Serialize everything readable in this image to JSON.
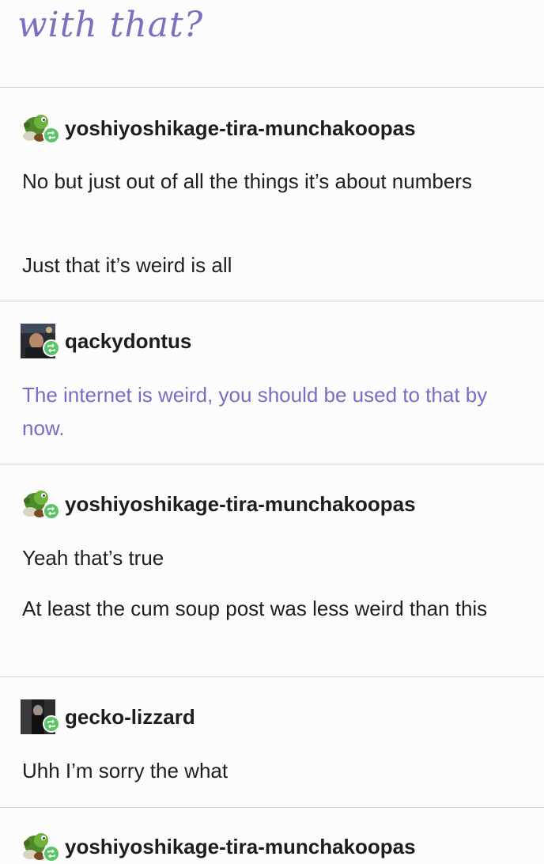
{
  "heading": "with that?",
  "posts": [
    {
      "username": "yoshiyoshikage-tira-munchakoopas",
      "avatar": "yoshi-avatar",
      "paragraphs": [
        "No but just out of all the things it’s about numbers",
        "Just that it’s weird is all"
      ]
    },
    {
      "username": "qackydontus",
      "avatar": "photo-avatar",
      "paragraphs": [
        "The internet is weird, you should be used to that by now."
      ]
    },
    {
      "username": "yoshiyoshikage-tira-munchakoopas",
      "avatar": "yoshi-avatar",
      "paragraphs": [
        "Yeah that’s true",
        "At least the cum soup post was less weird than this"
      ]
    },
    {
      "username": "gecko-lizzard",
      "avatar": "dark-photo-avatar",
      "paragraphs": [
        "Uhh I’m sorry the what"
      ]
    },
    {
      "username": "yoshiyoshikage-tira-munchakoopas",
      "avatar": "yoshi-avatar",
      "paragraphs": []
    }
  ],
  "colors": {
    "heading": "#7c6fc0",
    "quote_text": "#7b6bc2",
    "reblog_badge": "#5bc46a",
    "divider": "#d6d6d6"
  },
  "icons": {
    "reblog": "reblog-icon"
  }
}
